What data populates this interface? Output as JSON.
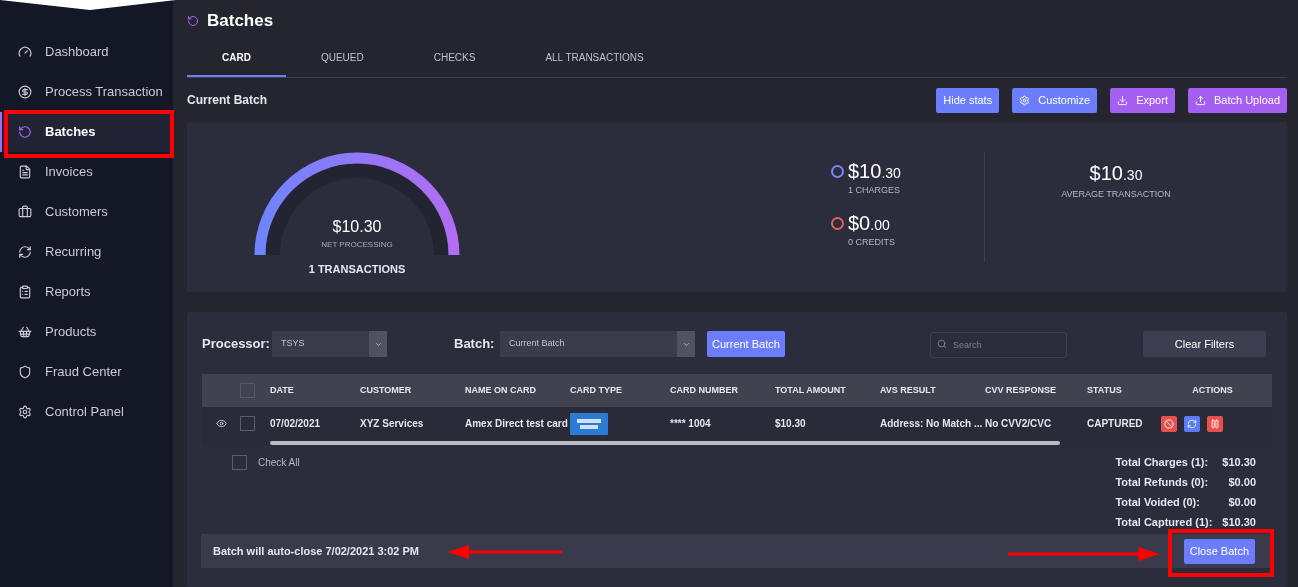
{
  "sidebar": {
    "items": [
      {
        "label": "Dashboard",
        "selected": false
      },
      {
        "label": "Process Transaction",
        "selected": false
      },
      {
        "label": "Batches",
        "selected": true
      },
      {
        "label": "Invoices",
        "selected": false
      },
      {
        "label": "Customers",
        "selected": false
      },
      {
        "label": "Recurring",
        "selected": false
      },
      {
        "label": "Reports",
        "selected": false
      },
      {
        "label": "Products",
        "selected": false
      },
      {
        "label": "Fraud Center",
        "selected": false
      },
      {
        "label": "Control Panel",
        "selected": false
      }
    ]
  },
  "page": {
    "title": "Batches"
  },
  "tabs": [
    {
      "label": "CARD",
      "selected": true
    },
    {
      "label": "QUEUED",
      "selected": false
    },
    {
      "label": "CHECKS",
      "selected": false
    },
    {
      "label": "ALL TRANSACTIONS",
      "selected": false
    }
  ],
  "section_title": "Current Batch",
  "toolbar": [
    {
      "label": "Hide stats",
      "kind": "plain",
      "color": "#6b7dfb"
    },
    {
      "label": "Customize",
      "kind": "gear",
      "color": "#6b7dfb"
    },
    {
      "label": "Export",
      "kind": "download",
      "color": "#a55ff0"
    },
    {
      "label": "Batch Upload",
      "kind": "upload",
      "color": "#a55ff0"
    }
  ],
  "stats": {
    "gauge": {
      "amount": "$10.30",
      "label": "NET PROCESSING",
      "count": "1 TRANSACTIONS"
    },
    "breakdown": [
      {
        "whole": "$10",
        "cents": ".30",
        "label": "1 CHARGES",
        "color": "#7b86f5"
      },
      {
        "whole": "$0",
        "cents": ".00",
        "label": "0 CREDITS",
        "color": "#e0605c"
      }
    ],
    "average": {
      "whole": "$10",
      "cents": ".30",
      "label": "AVERAGE TRANSACTION"
    }
  },
  "filters": {
    "processor": {
      "label": "Processor:",
      "value": "TSYS"
    },
    "batch": {
      "label": "Batch:",
      "value": "Current Batch"
    },
    "current_button": "Current Batch",
    "search": {
      "placeholder": "Search"
    },
    "clear_button": "Clear Filters"
  },
  "table": {
    "select_all_checked": false,
    "columns": [
      "DATE",
      "CUSTOMER",
      "NAME ON CARD",
      "CARD TYPE",
      "CARD NUMBER",
      "TOTAL AMOUNT",
      "AVS RESULT",
      "CVV RESPONSE",
      "STATUS",
      "ACTIONS"
    ],
    "rows": [
      {
        "checked": false,
        "date": "07/02/2021",
        "customer": "XYZ Services",
        "name_on_card": "Amex Direct test card",
        "card_number": "**** 1004",
        "total_amount": "$10.30",
        "avs_result": "Address: No Match ...",
        "cvv_response": "No CVV2/CVC",
        "status": "CAPTURED",
        "actions": [
          {
            "kind": "void"
          },
          {
            "kind": "refresh"
          },
          {
            "kind": "pause"
          }
        ]
      }
    ]
  },
  "check_all": {
    "label": "Check All",
    "checked": false
  },
  "totals": [
    {
      "label": "Total Charges (1):",
      "value": "$10.30"
    },
    {
      "label": "Total Refunds (0):",
      "value": "$0.00"
    },
    {
      "label": "Total Voided (0):",
      "value": "$0.00"
    },
    {
      "label": "Total Captured (1):",
      "value": "$10.30"
    }
  ],
  "footer": {
    "message": "Batch will auto-close 7/02/2021 3:02 PM",
    "close_button": "Close Batch"
  }
}
